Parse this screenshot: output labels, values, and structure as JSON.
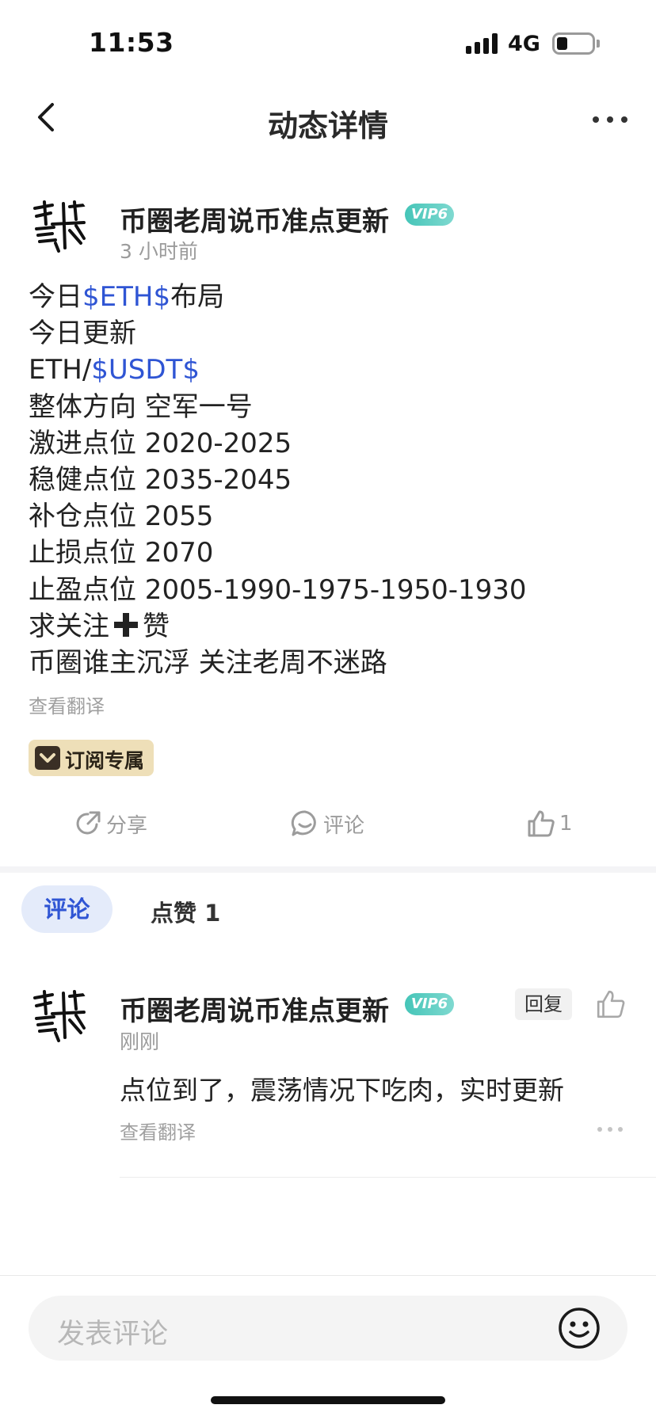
{
  "status_bar": {
    "time": "11:53",
    "network": "4G"
  },
  "nav": {
    "title": "动态详情"
  },
  "post": {
    "author": "币圈老周说币准点更新",
    "vip": "VIP6",
    "time": "3 小时前",
    "lines": [
      {
        "a": "今日",
        "tag": "$ETH$",
        "b": "布局"
      },
      {
        "a": "今日更新"
      },
      {
        "a": "ETH/",
        "tag": "$USDT$"
      },
      {
        "a": "整体方向 空军一号"
      },
      {
        "a": "激进点位 2020-2025"
      },
      {
        "a": "稳健点位 2035-2045"
      },
      {
        "a": "补仓点位 2055"
      },
      {
        "a": "止损点位 2070"
      },
      {
        "a": "止盈点位 2005-1990-1975-1950-1930"
      },
      {
        "a": "求关注",
        "b": "赞"
      },
      {
        "a": "币圈谁主沉浮 关注老周不迷路"
      }
    ],
    "translate": "查看翻译",
    "subscribe_label": "订阅专属"
  },
  "actions": {
    "share": "分享",
    "comment": "评论",
    "like_count": "1"
  },
  "tabs": {
    "comments": "评论",
    "likes": "点赞 1"
  },
  "comment": {
    "author": "币圈老周说币准点更新",
    "vip": "VIP6",
    "time": "刚刚",
    "reply": "回复",
    "text": "点位到了，震荡情况下吃肉，实时更新",
    "translate": "查看翻译"
  },
  "input": {
    "placeholder": "发表评论"
  }
}
